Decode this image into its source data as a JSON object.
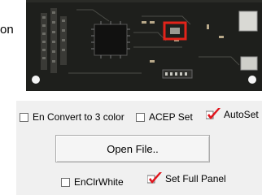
{
  "window": {
    "label_fragment": "on"
  },
  "options": {
    "convert3": {
      "label": "En Convert to 3 color",
      "checked": false
    },
    "acep": {
      "label": "ACEP Set",
      "checked": false
    },
    "autoset": {
      "label": "AutoSet",
      "checked": true
    },
    "enclrwhite": {
      "label": "EnClrWhite",
      "checked": false
    },
    "fullpanel": {
      "label": "Set Full Panel",
      "checked": true
    }
  },
  "buttons": {
    "open_file": "Open File.."
  },
  "colors": {
    "checkmark": "#e0151d",
    "panel_bg": "#f0f0f0",
    "board": "#1e1f1c",
    "highlight": "#e2231a"
  },
  "icons": {
    "preview": "circuit-board-photo",
    "check": "red-checkmark-icon"
  }
}
